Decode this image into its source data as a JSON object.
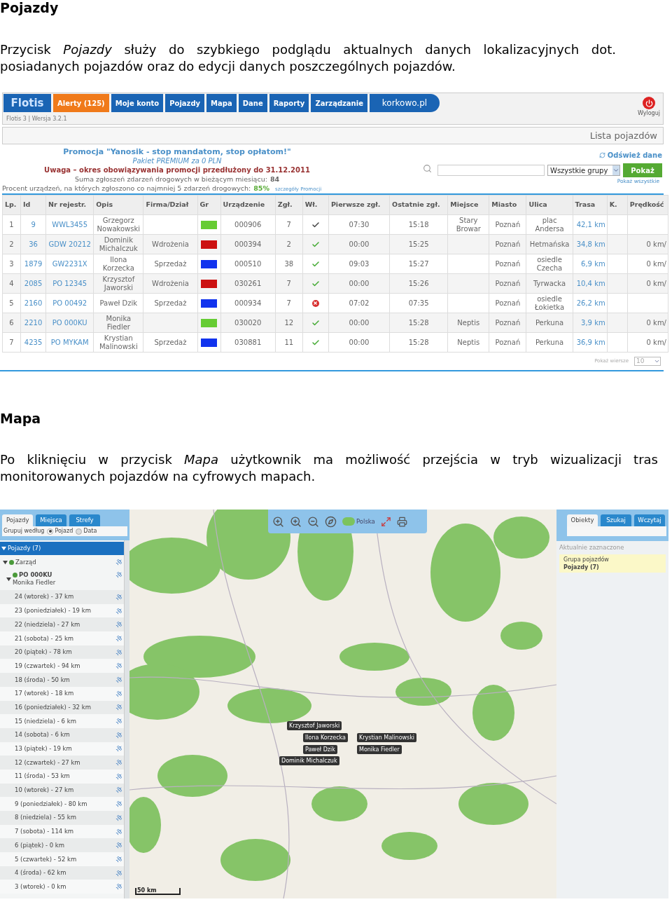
{
  "section_vehicles": {
    "heading": "Pojazdy",
    "paragraph": "Przycisk *Pojazdy* służy do szybkiego podglądu aktualnych danych lokalizacyjnych dot. posiadanych pojazdów oraz do edycji danych poszczególnych pojazdów."
  },
  "vehicles_app": {
    "logo": "Flotis",
    "nav": [
      {
        "label": "Alerty (125)",
        "kind": "tab",
        "selected": true
      },
      {
        "label": "Moje konto",
        "kind": "tab",
        "selected": false
      },
      {
        "label": "Pojazdy",
        "kind": "tab",
        "selected": false
      },
      {
        "label": "Mapa",
        "kind": "tab",
        "selected": false
      },
      {
        "label": "Dane",
        "kind": "tab",
        "selected": false
      },
      {
        "label": "Raporty",
        "kind": "tab",
        "selected": false
      },
      {
        "label": "Zarządzanie",
        "kind": "tab",
        "selected": false
      },
      {
        "label": "korkowo.pl",
        "kind": "brand",
        "selected": false
      }
    ],
    "logout": "Wyloguj",
    "version": "Flotis 3 | Wersja 3.2.1",
    "page_title": "Lista pojazdów",
    "promo": {
      "title": "Promocja \"Yanosik - stop mandatom, stop opłatom!\"",
      "subtitle": "Pakiet PREMIUM za 0 PLN",
      "notice": "Uwaga – okres obowiązywania promocji przedłużony do 31.12.2011",
      "sum_label": "Suma zgłoszeń zdarzeń drogowych w bieżącym miesiącu:",
      "sum_value": "84",
      "percent_label": "Procent urządzeń, na których zgłoszono co najmniej 5 zdarzeń drogowych:",
      "percent_value": "85%",
      "details_link": "szczegóły Promocji"
    },
    "refresh": "Odśwież dane",
    "group_select": "Wszystkie grupy",
    "show_button": "Pokaż",
    "show_all": "Pokaż wszystkie",
    "columns": [
      "Lp.",
      "Id",
      "Nr rejestr.",
      "Opis",
      "Firma/Dział",
      "Gr",
      "Urządzenie",
      "Zgł.",
      "Wł.",
      "Pierwsze zgł.",
      "Ostatnie zgł.",
      "Miejsce",
      "Miasto",
      "Ulica",
      "Trasa",
      "K.",
      "Prędkość"
    ],
    "rows": [
      {
        "lp": "1",
        "id": "9",
        "reg": "WWL3455",
        "desc": "Grzegorz Nowakowski",
        "dept": "",
        "color": "#66cc33",
        "device": "000906",
        "reports": "7",
        "wl": {
          "ok": true,
          "color": "#444444"
        },
        "first": "07:30",
        "last": "15:18",
        "place": "Stary Browar",
        "city": "Poznań",
        "street": "plac Andersa",
        "route": "42,1 km",
        "speed": ""
      },
      {
        "lp": "2",
        "id": "36",
        "reg": "GDW 20212",
        "desc": "Dominik Michalczuk",
        "dept": "Wdrożenia",
        "color": "#cc1111",
        "device": "000394",
        "reports": "2",
        "wl": {
          "ok": true,
          "color": "#44aa33"
        },
        "first": "00:00",
        "last": "15:25",
        "place": "",
        "city": "Poznań",
        "street": "Hetmańska",
        "route": "34,8 km",
        "speed": "0 km/"
      },
      {
        "lp": "3",
        "id": "1879",
        "reg": "GW2231X",
        "desc": "Ilona Korzecka",
        "dept": "Sprzedaż",
        "color": "#1133ee",
        "device": "000510",
        "reports": "38",
        "wl": {
          "ok": true,
          "color": "#44aa33"
        },
        "first": "09:03",
        "last": "15:27",
        "place": "",
        "city": "Poznań",
        "street": "osiedle Czecha",
        "route": "6,9 km",
        "speed": "0 km/"
      },
      {
        "lp": "4",
        "id": "2085",
        "reg": "PO 12345",
        "desc": "Krzysztof Jaworski",
        "dept": "Wdrożenia",
        "color": "#cc1111",
        "device": "030261",
        "reports": "7",
        "wl": {
          "ok": true,
          "color": "#44aa33"
        },
        "first": "00:00",
        "last": "15:26",
        "place": "",
        "city": "Poznań",
        "street": "Tyrwacka",
        "route": "10,4 km",
        "speed": "0 km/"
      },
      {
        "lp": "5",
        "id": "2160",
        "reg": "PO 00492",
        "desc": "Paweł Dzik",
        "dept": "Sprzedaż",
        "color": "#1133ee",
        "device": "000934",
        "reports": "7",
        "wl": {
          "ok": false,
          "color": "#d83030"
        },
        "first": "07:02",
        "last": "07:35",
        "place": "",
        "city": "Poznań",
        "street": "osiedle Łokietka",
        "route": "26,2 km",
        "speed": ""
      },
      {
        "lp": "6",
        "id": "2210",
        "reg": "PO 000KU",
        "desc": "Monika Fiedler",
        "dept": "",
        "color": "#66cc33",
        "device": "030020",
        "reports": "12",
        "wl": {
          "ok": true,
          "color": "#44aa33"
        },
        "first": "00:00",
        "last": "15:28",
        "place": "Neptis",
        "city": "Poznań",
        "street": "Perkuna",
        "route": "3,9 km",
        "speed": "0 km/"
      },
      {
        "lp": "7",
        "id": "4235",
        "reg": "PO MYKAM",
        "desc": "Krystian Malinowski",
        "dept": "Sprzedaż",
        "color": "#1133ee",
        "device": "030881",
        "reports": "11",
        "wl": {
          "ok": true,
          "color": "#44aa33"
        },
        "first": "00:00",
        "last": "15:28",
        "place": "Neptis",
        "city": "Poznań",
        "street": "Perkuna",
        "route": "36,9 km",
        "speed": "0 km/"
      }
    ],
    "rows_label": "Pokaż wiersze",
    "rows_value": "10"
  },
  "section_map": {
    "heading": "Mapa",
    "paragraph": "Po kliknięciu w przycisk *Mapa* użytkownik ma możliwość przejścia w tryb wizualizacji tras monitorowanych pojazdów na cyfrowych mapach."
  },
  "map_app": {
    "left_tabs": [
      {
        "label": "Pojazdy",
        "selected": true
      },
      {
        "label": "Miejsca",
        "selected": false
      },
      {
        "label": "Strefy",
        "selected": false
      }
    ],
    "group_by": {
      "label": "Grupuj według",
      "options": [
        {
          "label": "Pojazd",
          "selected": true
        },
        {
          "label": "Data",
          "selected": false
        }
      ]
    },
    "tree": {
      "label": "Pojazdy (7)",
      "expanded": true,
      "children": [
        {
          "label": "Zarząd",
          "expanded": true,
          "children": [
            {
              "label": "PO 000KU",
              "sublabel": "Monika Fiedler",
              "expanded": true,
              "children": [
                {
                  "label": "24 (wtorek) - 37 km"
                },
                {
                  "label": "23 (poniedziałek) - 19 km"
                },
                {
                  "label": "22 (niedziela) - 27 km"
                },
                {
                  "label": "21 (sobota) - 25 km"
                },
                {
                  "label": "20 (piątek) - 78 km"
                },
                {
                  "label": "19 (czwartek) - 94 km"
                },
                {
                  "label": "18 (środa) - 50 km"
                },
                {
                  "label": "17 (wtorek) - 18 km"
                },
                {
                  "label": "16 (poniedziałek) - 32 km"
                },
                {
                  "label": "15 (niedziela) - 6 km"
                },
                {
                  "label": "14 (sobota) - 6 km"
                },
                {
                  "label": "13 (piątek) - 19 km"
                },
                {
                  "label": "12 (czwartek) - 27 km"
                },
                {
                  "label": "11 (środa) - 53 km"
                },
                {
                  "label": "10 (wtorek) - 27 km"
                },
                {
                  "label": "9 (poniedziałek) - 80 km"
                },
                {
                  "label": "8 (niedziela) - 55 km"
                },
                {
                  "label": "7 (sobota) - 114 km"
                },
                {
                  "label": "6 (piątek) - 0 km"
                },
                {
                  "label": "5 (czwartek) - 52 km"
                },
                {
                  "label": "4 (środa) - 62 km"
                },
                {
                  "label": "3 (wtorek) - 0 km"
                }
              ]
            }
          ]
        }
      ]
    },
    "region": "Polska",
    "right_tabs": [
      {
        "label": "Obiekty",
        "selected": true
      },
      {
        "label": "Szukaj",
        "selected": false
      },
      {
        "label": "Wczytaj",
        "selected": false
      }
    ],
    "selection": {
      "title": "Aktualnie zaznaczone",
      "group_label": "Grupa pojazdów",
      "group_value": "Pojazdy (7)"
    },
    "markers": [
      {
        "label": "Krzysztof Jaworski"
      },
      {
        "label": "Ilona Korzecka"
      },
      {
        "label": "Krystian Malinowski"
      },
      {
        "label": "Paweł Dzik"
      },
      {
        "label": "Monika Fiedler"
      },
      {
        "label": "Dominik Michalczuk"
      }
    ],
    "scale": "50 km"
  }
}
